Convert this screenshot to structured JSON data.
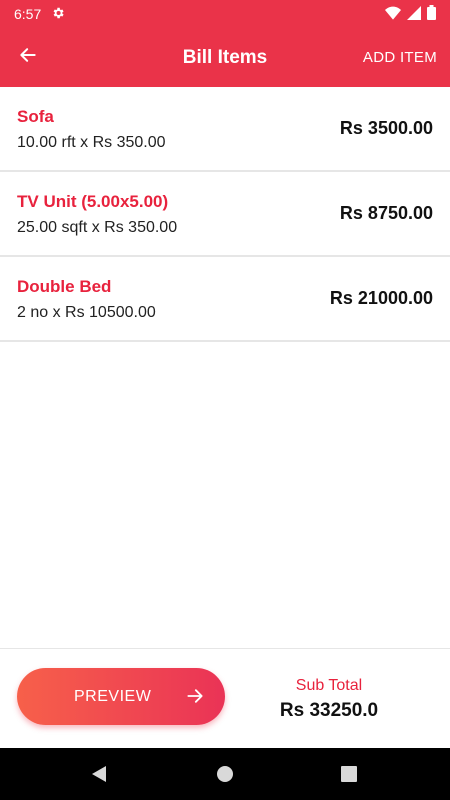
{
  "status_bar": {
    "time": "6:57",
    "icons": [
      "settings-icon",
      "wifi-icon",
      "signal-icon",
      "battery-icon"
    ]
  },
  "app_bar": {
    "title": "Bill Items",
    "action_label": "ADD ITEM",
    "back_icon": "arrow-back-icon"
  },
  "items": [
    {
      "name": "Sofa",
      "detail": "10.00 rft x Rs 350.00",
      "amount": "Rs 3500.00"
    },
    {
      "name": "TV Unit (5.00x5.00)",
      "detail": "25.00 sqft x Rs 350.00",
      "amount": "Rs 8750.00"
    },
    {
      "name": "Double Bed",
      "detail": "2 no x Rs 10500.00",
      "amount": "Rs 21000.00"
    }
  ],
  "footer": {
    "preview_label": "PREVIEW",
    "preview_icon": "arrow-forward-icon",
    "subtotal_label": "Sub Total",
    "subtotal_value": "Rs 33250.0"
  },
  "nav_bar": {
    "icons": [
      "back-triangle-icon",
      "home-circle-icon",
      "recents-square-icon"
    ]
  },
  "colors": {
    "primary": "#ea3349",
    "accent_text": "#e8223d",
    "gradient_start": "#f7604a",
    "gradient_end": "#ea3356"
  }
}
